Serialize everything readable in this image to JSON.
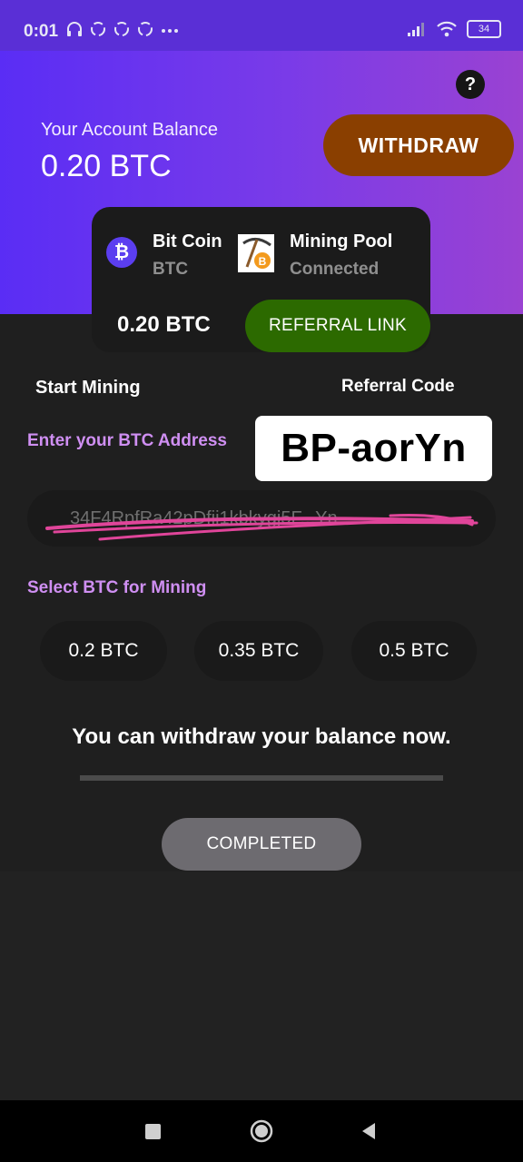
{
  "status_bar": {
    "time": "0:01",
    "left_icons": [
      "headphones-icon",
      "sync-icon",
      "sync-icon",
      "sync-icon",
      "more-dots-icon"
    ],
    "right_icons": [
      "signal-icon",
      "wifi-icon"
    ],
    "battery": "34"
  },
  "header": {
    "help_label": "?",
    "balance_label": "Your Account Balance",
    "balance_value": "0.20 BTC",
    "withdraw_label": "WITHDRAW",
    "gradient_colors": [
      "#5a2df5",
      "#9a42d2"
    ]
  },
  "card": {
    "coin_name": "Bit Coin",
    "coin_symbol": "BTC",
    "pool_name": "Mining Pool",
    "pool_status": "Connected",
    "balance": "0.20 BTC",
    "referral_label": "REFERRAL LINK"
  },
  "mining": {
    "start_label": "Start Mining",
    "referral_code_label": "Referral Code",
    "referral_code": "BP-aorYn",
    "address_label": "Enter your BTC Address",
    "address_value": "34F4RpfRa42pDfii1kbkygj5F...Yn",
    "select_label": "Select BTC for Mining",
    "amounts": [
      "0.2 BTC",
      "0.35 BTC",
      "0.5 BTC"
    ],
    "message": "You can withdraw your balance now.",
    "progress": 1.0,
    "completed_label": "COMPLETED"
  },
  "colors": {
    "accent_purple": "#5a2fd6",
    "label_lavender": "#cf8ff2",
    "withdraw_brown": "#8a3f00",
    "referral_green": "#2c6a00",
    "scribble_pink": "#e0459a"
  },
  "nav_bar": {
    "icons": [
      "recent-apps-icon",
      "home-icon",
      "back-icon"
    ]
  }
}
